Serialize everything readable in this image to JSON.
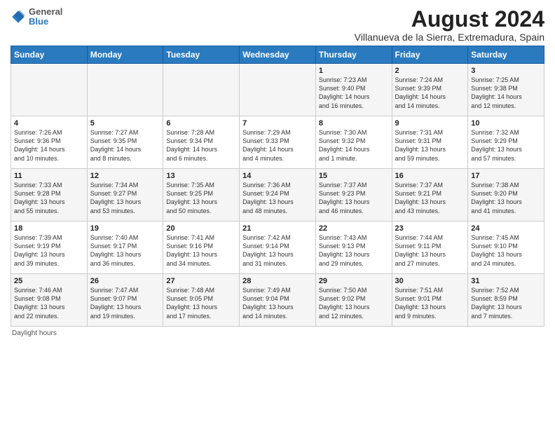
{
  "header": {
    "logo_line1": "General",
    "logo_line2": "Blue",
    "title": "August 2024",
    "subtitle": "Villanueva de la Sierra, Extremadura, Spain"
  },
  "calendar": {
    "days_of_week": [
      "Sunday",
      "Monday",
      "Tuesday",
      "Wednesday",
      "Thursday",
      "Friday",
      "Saturday"
    ],
    "weeks": [
      [
        {
          "day": null,
          "info": null
        },
        {
          "day": null,
          "info": null
        },
        {
          "day": null,
          "info": null
        },
        {
          "day": null,
          "info": null
        },
        {
          "day": "1",
          "info": "Sunrise: 7:23 AM\nSunset: 9:40 PM\nDaylight: 14 hours\nand 16 minutes."
        },
        {
          "day": "2",
          "info": "Sunrise: 7:24 AM\nSunset: 9:39 PM\nDaylight: 14 hours\nand 14 minutes."
        },
        {
          "day": "3",
          "info": "Sunrise: 7:25 AM\nSunset: 9:38 PM\nDaylight: 14 hours\nand 12 minutes."
        }
      ],
      [
        {
          "day": "4",
          "info": "Sunrise: 7:26 AM\nSunset: 9:36 PM\nDaylight: 14 hours\nand 10 minutes."
        },
        {
          "day": "5",
          "info": "Sunrise: 7:27 AM\nSunset: 9:35 PM\nDaylight: 14 hours\nand 8 minutes."
        },
        {
          "day": "6",
          "info": "Sunrise: 7:28 AM\nSunset: 9:34 PM\nDaylight: 14 hours\nand 6 minutes."
        },
        {
          "day": "7",
          "info": "Sunrise: 7:29 AM\nSunset: 9:33 PM\nDaylight: 14 hours\nand 4 minutes."
        },
        {
          "day": "8",
          "info": "Sunrise: 7:30 AM\nSunset: 9:32 PM\nDaylight: 14 hours\nand 1 minute."
        },
        {
          "day": "9",
          "info": "Sunrise: 7:31 AM\nSunset: 9:31 PM\nDaylight: 13 hours\nand 59 minutes."
        },
        {
          "day": "10",
          "info": "Sunrise: 7:32 AM\nSunset: 9:29 PM\nDaylight: 13 hours\nand 57 minutes."
        }
      ],
      [
        {
          "day": "11",
          "info": "Sunrise: 7:33 AM\nSunset: 9:28 PM\nDaylight: 13 hours\nand 55 minutes."
        },
        {
          "day": "12",
          "info": "Sunrise: 7:34 AM\nSunset: 9:27 PM\nDaylight: 13 hours\nand 53 minutes."
        },
        {
          "day": "13",
          "info": "Sunrise: 7:35 AM\nSunset: 9:25 PM\nDaylight: 13 hours\nand 50 minutes."
        },
        {
          "day": "14",
          "info": "Sunrise: 7:36 AM\nSunset: 9:24 PM\nDaylight: 13 hours\nand 48 minutes."
        },
        {
          "day": "15",
          "info": "Sunrise: 7:37 AM\nSunset: 9:23 PM\nDaylight: 13 hours\nand 46 minutes."
        },
        {
          "day": "16",
          "info": "Sunrise: 7:37 AM\nSunset: 9:21 PM\nDaylight: 13 hours\nand 43 minutes."
        },
        {
          "day": "17",
          "info": "Sunrise: 7:38 AM\nSunset: 9:20 PM\nDaylight: 13 hours\nand 41 minutes."
        }
      ],
      [
        {
          "day": "18",
          "info": "Sunrise: 7:39 AM\nSunset: 9:19 PM\nDaylight: 13 hours\nand 39 minutes."
        },
        {
          "day": "19",
          "info": "Sunrise: 7:40 AM\nSunset: 9:17 PM\nDaylight: 13 hours\nand 36 minutes."
        },
        {
          "day": "20",
          "info": "Sunrise: 7:41 AM\nSunset: 9:16 PM\nDaylight: 13 hours\nand 34 minutes."
        },
        {
          "day": "21",
          "info": "Sunrise: 7:42 AM\nSunset: 9:14 PM\nDaylight: 13 hours\nand 31 minutes."
        },
        {
          "day": "22",
          "info": "Sunrise: 7:43 AM\nSunset: 9:13 PM\nDaylight: 13 hours\nand 29 minutes."
        },
        {
          "day": "23",
          "info": "Sunrise: 7:44 AM\nSunset: 9:11 PM\nDaylight: 13 hours\nand 27 minutes."
        },
        {
          "day": "24",
          "info": "Sunrise: 7:45 AM\nSunset: 9:10 PM\nDaylight: 13 hours\nand 24 minutes."
        }
      ],
      [
        {
          "day": "25",
          "info": "Sunrise: 7:46 AM\nSunset: 9:08 PM\nDaylight: 13 hours\nand 22 minutes."
        },
        {
          "day": "26",
          "info": "Sunrise: 7:47 AM\nSunset: 9:07 PM\nDaylight: 13 hours\nand 19 minutes."
        },
        {
          "day": "27",
          "info": "Sunrise: 7:48 AM\nSunset: 9:05 PM\nDaylight: 13 hours\nand 17 minutes."
        },
        {
          "day": "28",
          "info": "Sunrise: 7:49 AM\nSunset: 9:04 PM\nDaylight: 13 hours\nand 14 minutes."
        },
        {
          "day": "29",
          "info": "Sunrise: 7:50 AM\nSunset: 9:02 PM\nDaylight: 13 hours\nand 12 minutes."
        },
        {
          "day": "30",
          "info": "Sunrise: 7:51 AM\nSunset: 9:01 PM\nDaylight: 13 hours\nand 9 minutes."
        },
        {
          "day": "31",
          "info": "Sunrise: 7:52 AM\nSunset: 8:59 PM\nDaylight: 13 hours\nand 7 minutes."
        }
      ]
    ],
    "footer": "Daylight hours"
  }
}
